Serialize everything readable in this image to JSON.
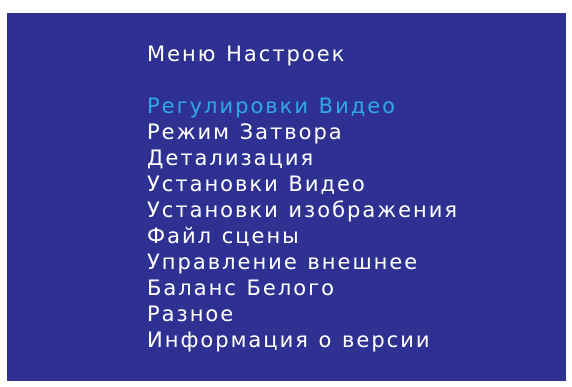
{
  "menu": {
    "title": "Меню Настроек",
    "selected_color": "#31a7e8",
    "background_color": "#2e3192",
    "text_color": "#ffffff",
    "items": [
      {
        "label": "Регулировки Видео",
        "selected": true
      },
      {
        "label": "Режим Затвора",
        "selected": false
      },
      {
        "label": "Детализация",
        "selected": false
      },
      {
        "label": "Установки Видео",
        "selected": false
      },
      {
        "label": "Установки изображения",
        "selected": false
      },
      {
        "label": "Файл сцены",
        "selected": false
      },
      {
        "label": "Управление внешнее",
        "selected": false
      },
      {
        "label": "Баланс Белого",
        "selected": false
      },
      {
        "label": "Разное",
        "selected": false
      },
      {
        "label": "Информация о версии",
        "selected": false
      }
    ]
  }
}
